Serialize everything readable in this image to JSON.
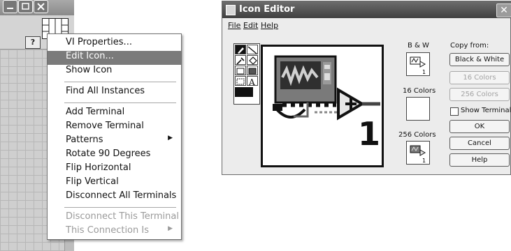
{
  "context_menu": {
    "items": [
      {
        "label": "VI Properties..."
      },
      {
        "label": "Edit Icon..."
      },
      {
        "label": "Show Icon"
      },
      {
        "label": "Find All Instances"
      },
      {
        "label": "Add Terminal"
      },
      {
        "label": "Remove Terminal"
      },
      {
        "label": "Patterns"
      },
      {
        "label": "Rotate 90 Degrees"
      },
      {
        "label": "Flip Horizontal"
      },
      {
        "label": "Flip Vertical"
      },
      {
        "label": "Disconnect All Terminals"
      },
      {
        "label": "Disconnect This Terminal"
      },
      {
        "label": "This Connection Is"
      }
    ],
    "highlighted": "Edit Icon..."
  },
  "icon_editor": {
    "title": "Icon Editor",
    "menu": {
      "file": "File",
      "edit": "Edit",
      "help": "Help"
    },
    "labels": {
      "bw": "B & W",
      "sixteen": "16 Colors",
      "twofiftysix": "256 Colors",
      "copy_from": "Copy from:",
      "icon_number": "1"
    },
    "buttons": {
      "black_white": "Black & White",
      "sixteen_colors": "16 Colors",
      "twofiftysix_colors": "256 Colors",
      "ok": "OK",
      "cancel": "Cancel",
      "help": "Help"
    },
    "show_terminals": "Show Terminals",
    "show_terminals_checked": false
  }
}
